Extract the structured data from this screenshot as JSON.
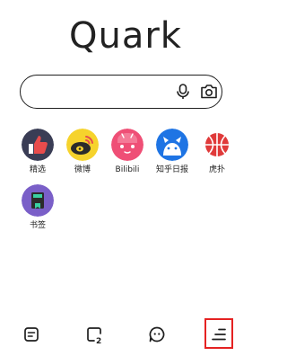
{
  "app": {
    "logo_text": "Quark"
  },
  "search": {
    "value": "",
    "placeholder": ""
  },
  "icons": {
    "voice": "microphone-icon",
    "camera": "camera-icon"
  },
  "shortcuts": [
    {
      "label": "精选",
      "icon": "thumbs-up-icon",
      "color": "#e84c4c"
    },
    {
      "label": "微博",
      "icon": "weibo-icon",
      "color": "#f6d32c"
    },
    {
      "label": "Bilibili",
      "icon": "bilibili-icon",
      "color": "#ef4f76"
    },
    {
      "label": "知乎日报",
      "icon": "zhihu-daily-icon",
      "color": "#1e74e4"
    },
    {
      "label": "虎扑",
      "icon": "hupu-icon",
      "color": "#e03a3a"
    },
    {
      "label": "书签",
      "icon": "bookmark-icon",
      "color": "#7a5fc8"
    }
  ],
  "bottom_bar": {
    "items": [
      {
        "name": "news-feed-icon"
      },
      {
        "name": "tabs-icon",
        "badge": "2"
      },
      {
        "name": "assistant-icon"
      },
      {
        "name": "menu-icon",
        "highlighted": true
      }
    ],
    "highlight_color": "#e52222"
  }
}
